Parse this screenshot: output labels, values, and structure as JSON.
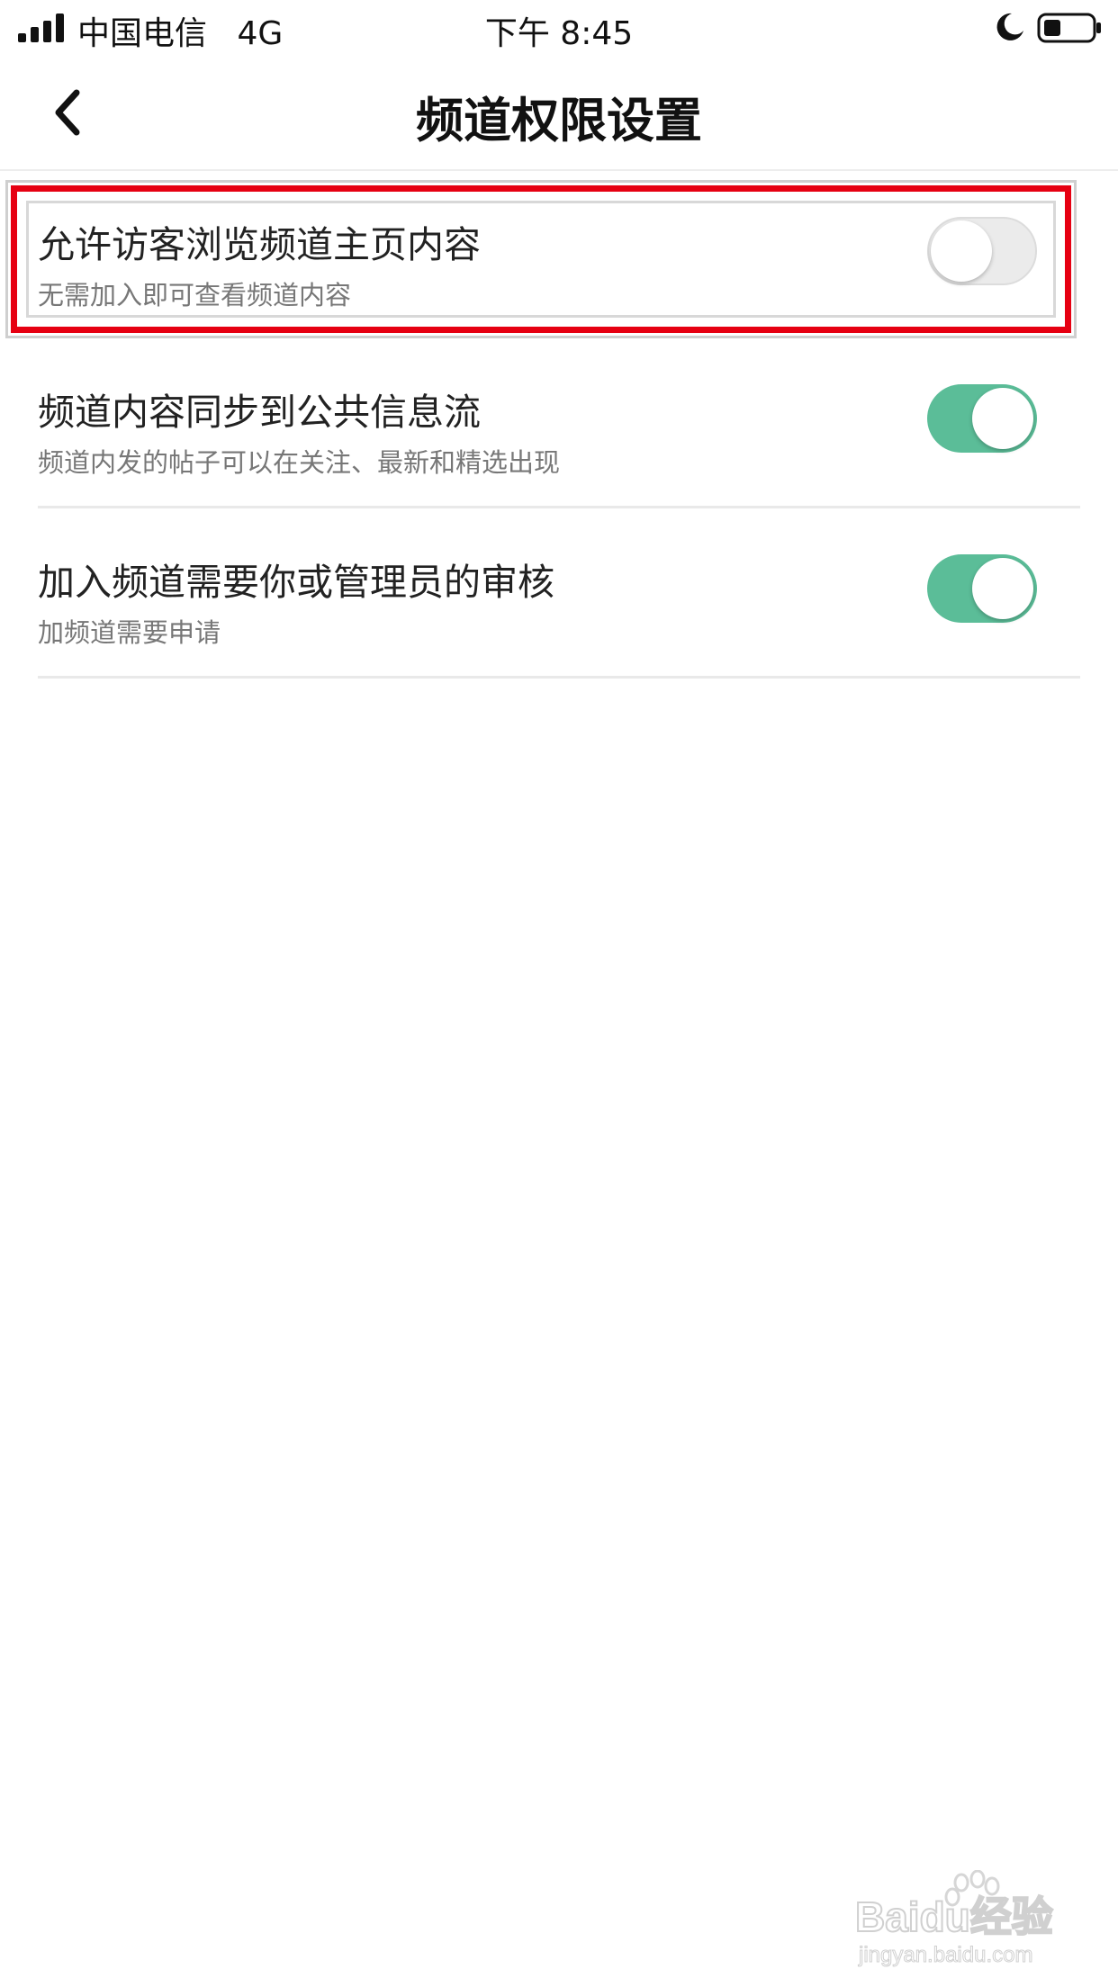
{
  "status_bar": {
    "carrier": "中国电信",
    "network": "4G",
    "time": "下午 8:45"
  },
  "nav": {
    "title": "频道权限设置",
    "back_icon": "chevron-left-icon"
  },
  "settings": [
    {
      "title": "允许访客浏览频道主页内容",
      "subtitle": "无需加入即可查看频道内容",
      "enabled": false,
      "highlighted": true
    },
    {
      "title": "频道内容同步到公共信息流",
      "subtitle": "频道内发的帖子可以在关注、最新和精选出现",
      "enabled": true,
      "highlighted": false
    },
    {
      "title": "加入频道需要你或管理员的审核",
      "subtitle": "加频道需要申请",
      "enabled": true,
      "highlighted": false
    }
  ],
  "colors": {
    "toggle_on": "#5bbd98",
    "toggle_off": "#ebebeb",
    "highlight_border": "#e60012"
  },
  "watermark": {
    "brand": "Baidu经验",
    "url": "jingyan.baidu.com"
  }
}
